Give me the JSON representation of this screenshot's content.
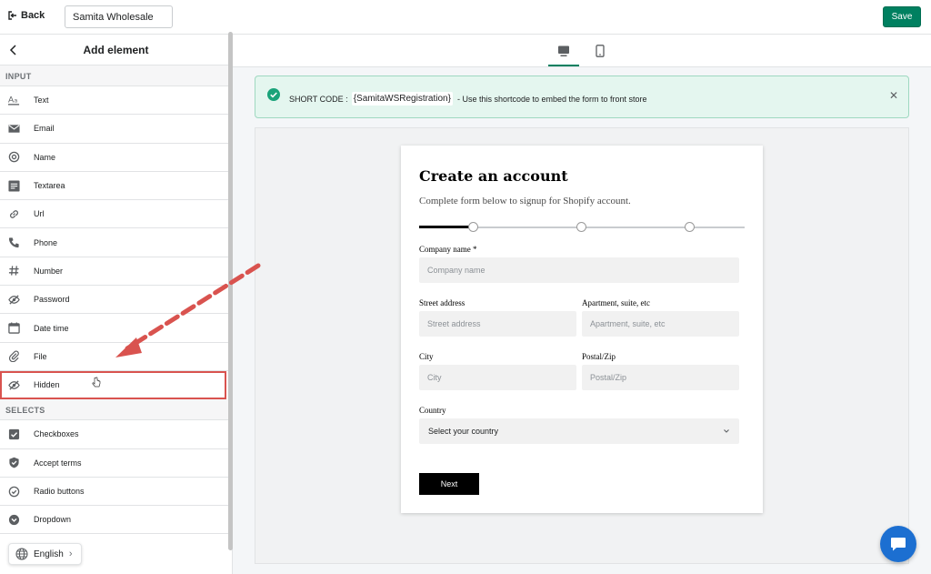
{
  "topbar": {
    "back_label": "Back",
    "form_name_value": "Samita Wholesale",
    "save_label": "Save",
    "save_color": "#008060"
  },
  "sidebar": {
    "title": "Add element",
    "sections": {
      "input": "INPUT",
      "selects": "SELECTS"
    },
    "input_items": [
      {
        "label": "Text",
        "icon": "text-format-icon"
      },
      {
        "label": "Email",
        "icon": "envelope-icon"
      },
      {
        "label": "Name",
        "icon": "at-sign-icon"
      },
      {
        "label": "Textarea",
        "icon": "textarea-icon"
      },
      {
        "label": "Url",
        "icon": "link-icon"
      },
      {
        "label": "Phone",
        "icon": "phone-icon"
      },
      {
        "label": "Number",
        "icon": "hash-icon"
      },
      {
        "label": "Password",
        "icon": "eye-off-icon"
      },
      {
        "label": "Date time",
        "icon": "calendar-icon"
      },
      {
        "label": "File",
        "icon": "paperclip-icon"
      },
      {
        "label": "Hidden",
        "icon": "eye-off-icon"
      }
    ],
    "select_items": [
      {
        "label": "Checkboxes",
        "icon": "checkbox-icon"
      },
      {
        "label": "Accept terms",
        "icon": "shield-check-icon"
      },
      {
        "label": "Radio buttons",
        "icon": "radio-icon"
      },
      {
        "label": "Dropdown",
        "icon": "chevron-circle-icon"
      }
    ],
    "language": "English"
  },
  "banner": {
    "prefix": "SHORT CODE :",
    "code": "{SamitaWSRegistration}",
    "suffix": "- Use this shortcode to embed the form to front store"
  },
  "form": {
    "title": "Create an account",
    "subtitle": "Complete form below to signup for Shopify account.",
    "progress": 0.16,
    "fields": {
      "company_label": "Company name *",
      "company_placeholder": "Company name",
      "street_label": "Street address",
      "street_placeholder": "Street address",
      "apt_label": "Apartment, suite, etc",
      "apt_placeholder": "Apartment, suite, etc",
      "city_label": "City",
      "city_placeholder": "City",
      "zip_label": "Postal/Zip",
      "zip_placeholder": "Postal/Zip",
      "country_label": "Country",
      "country_value": "Select your country"
    },
    "next_label": "Next"
  }
}
